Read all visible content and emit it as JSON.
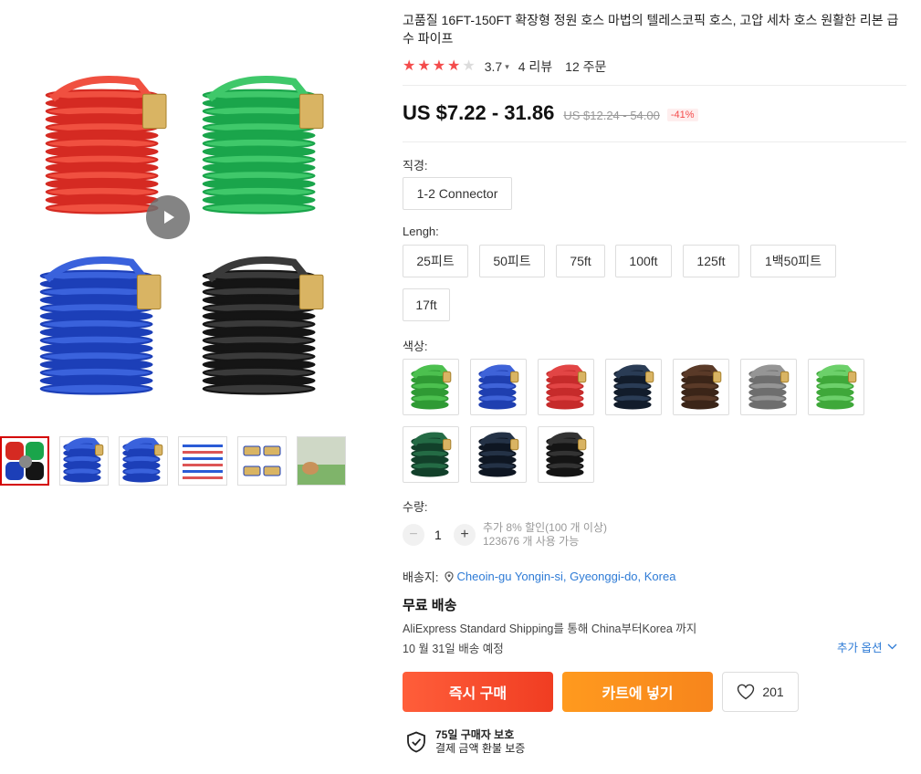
{
  "product": {
    "title": "고품질 16FT-150FT 확장형 정원 호스 마법의 텔레스코픽 호스, 고압 세차 호스 원활한 리본 급수 파이프",
    "rating": "3.7",
    "stars_filled": 4,
    "reviews": "4 리뷰",
    "orders": "12 주문",
    "price": "US $7.22 - 31.86",
    "original_price": "US $12.24 - 54.00",
    "discount": "-41%"
  },
  "icons": {
    "play": "play-icon",
    "star": "star-icon",
    "location": "location-pin-icon",
    "chevron": "chevron-down-icon",
    "heart": "heart-icon",
    "shield": "shield-check-icon"
  },
  "colors": {
    "accent_red": "#f44b4b",
    "buy_now": "#f03d22",
    "add_to_cart": "#f7851c",
    "link_blue": "#2e7bd6"
  },
  "gallery": {
    "main_hoses": [
      "red",
      "green",
      "blue",
      "black"
    ],
    "thumbnails": [
      "four-color hoses",
      "blue coiled hose",
      "blue hose loops",
      "size chart",
      "hose connectors",
      "garden watering scene"
    ]
  },
  "diameter": {
    "label": "직경:",
    "options": [
      "1-2 Connector"
    ]
  },
  "length": {
    "label": "Lengh:",
    "options": [
      "25피트",
      "50피트",
      "75ft",
      "100ft",
      "125ft",
      "1백50피트",
      "17ft"
    ]
  },
  "color": {
    "label": "색상:",
    "swatches": [
      {
        "hose": "#2f9a34",
        "light": "#4cc04f"
      },
      {
        "hose": "#1f3fb0",
        "light": "#3f63d8"
      },
      {
        "hose": "#c62b2b",
        "light": "#e24545"
      },
      {
        "hose": "#121c2b",
        "light": "#2a3c55"
      },
      {
        "hose": "#3b2518",
        "light": "#5a3a28"
      },
      {
        "hose": "#6e6e6e",
        "light": "#959595"
      },
      {
        "hose": "#3fa83a",
        "light": "#6cd06a"
      },
      {
        "hose": "#12402a",
        "light": "#246b45"
      },
      {
        "hose": "#0e1622",
        "light": "#243246"
      },
      {
        "hose": "#141414",
        "light": "#333333"
      }
    ]
  },
  "quantity": {
    "label": "수량:",
    "value": "1",
    "minus": "−",
    "plus": "+",
    "note_discount": "추가 8% 할인(100 개 이상)",
    "note_available": "123676 개 사용 가능"
  },
  "shipping": {
    "label": "배송지:",
    "location": "Cheoin-gu Yongin-si, Gyeonggi-do, Korea",
    "free": "무료 배송",
    "method": "AliExpress Standard Shipping를 통해 China부터Korea 까지",
    "delivery": "10 월 31일 배송 예정",
    "more_options": "추가 옵션"
  },
  "actions": {
    "buy_now": "즉시 구매",
    "add_to_cart": "카트에 넣기",
    "wishlist_count": "201"
  },
  "protection": {
    "title": "75일 구매자 보호",
    "subtitle": "결제 금액 환불 보증"
  }
}
